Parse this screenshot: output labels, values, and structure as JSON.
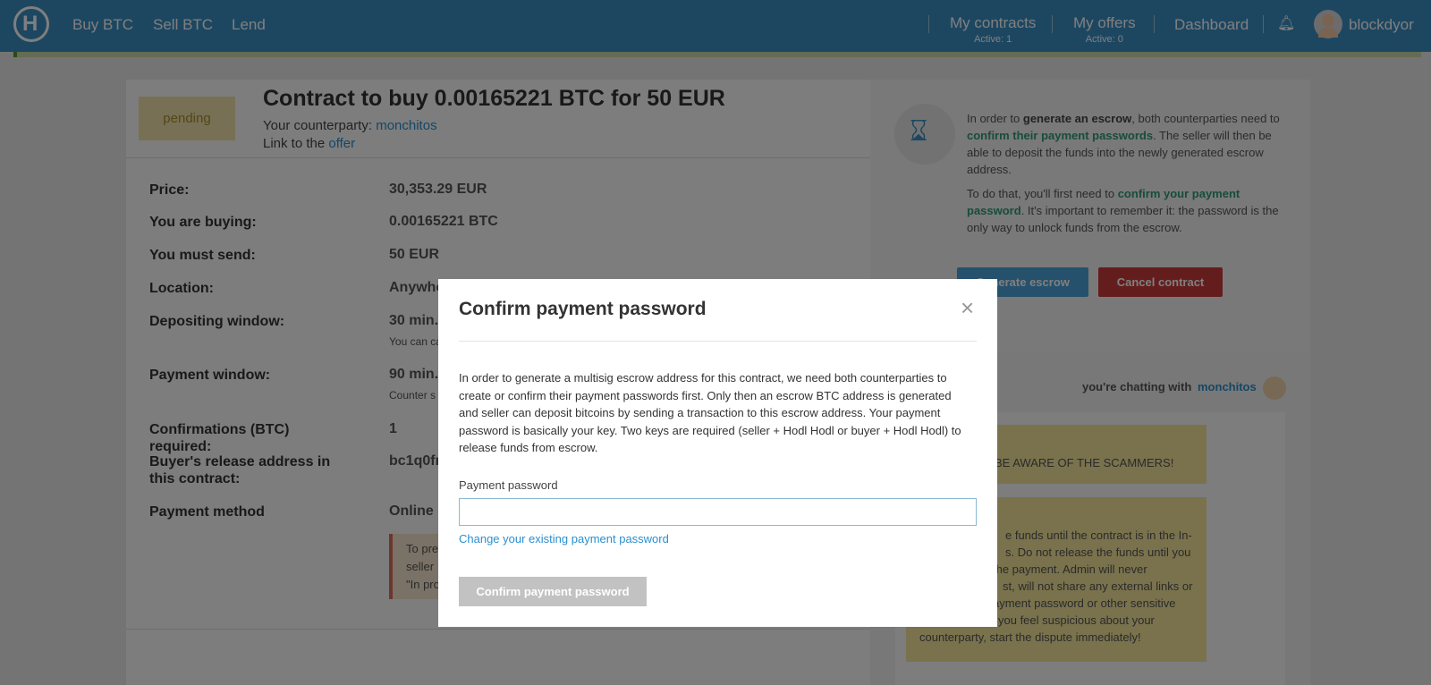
{
  "nav": {
    "logo": "H",
    "buy": "Buy BTC",
    "sell": "Sell BTC",
    "lend": "Lend",
    "contracts": "My contracts",
    "contracts_sub": "Active: 1",
    "offers": "My offers",
    "offers_sub": "Active: 0",
    "dashboard": "Dashboard",
    "username": "blockdyor",
    "bell_icon": "bell-icon"
  },
  "contract": {
    "status": "pending",
    "title": "Contract to buy 0.00165221 BTC for 50 EUR",
    "counterparty_prefix": "Your counterparty: ",
    "counterparty": "monchitos",
    "link_prefix": "Link to the ",
    "link_text": "offer",
    "rows": [
      {
        "label": "Price:",
        "value": "30,353.29 EUR"
      },
      {
        "label": "You are buying:",
        "value": "0.00165221 BTC"
      },
      {
        "label": "You must send:",
        "value": "50 EUR"
      },
      {
        "label": "Location:",
        "value": "Anywhe"
      },
      {
        "label": "Depositing window:",
        "value": "30 min.",
        "note": "You can ca"
      },
      {
        "label": "Payment window:",
        "value": "90 min.",
        "note": "Counter s"
      },
      {
        "label": "Confirmations (BTC) required:",
        "value": "1"
      },
      {
        "label": "Buyer's release address in this contract:",
        "value": "bc1q0fr"
      },
      {
        "label": "Payment method",
        "value": "Online p"
      }
    ],
    "warning": [
      "To pre",
      "seller",
      "\"In pro"
    ]
  },
  "escrow": {
    "p1_a": "In order to ",
    "p1_b": "generate an escrow",
    "p1_c": ", both counterparties need to ",
    "p1_d": "confirm their payment passwords",
    "p1_e": ". The seller will then be able to deposit the funds into the newly generated escrow address.",
    "p2_a": "To do that, you'll first need to ",
    "p2_b": "confirm your payment password",
    "p2_c": ". It's important to remember it: the password is the only way to unlock funds from the escrow.",
    "generate_btn": "Generate escrow",
    "cancel_btn": "Cancel contract"
  },
  "chat": {
    "with_label": "you're chatting with",
    "with_name": "monchitos",
    "msg1": "BE AWARE OF THE SCAMMERS!",
    "msg2": [
      "e funds until the contract is in the In-",
      "s. Do not release the funds until you",
      "the payment. Admin will never",
      "st, will not share any external links or",
      "ayment password or other sensitive",
      "you feel suspicious about your",
      "counterparty, start the dispute immediately!"
    ]
  },
  "modal": {
    "title": "Confirm payment password",
    "close": "×",
    "body": "In order to generate a multisig escrow address for this contract, we need both counterparties to create or confirm their payment passwords first. Only then an escrow BTC address is generated and seller can deposit bitcoins by sending a transaction to this escrow address. Your payment password is basically your key. Two keys are required (seller + Hodl Hodl or buyer + Hodl Hodl) to release funds from escrow.",
    "field_label": "Payment password",
    "field_value": "",
    "change_link": "Change your existing payment password",
    "confirm_btn": "Confirm payment password"
  }
}
